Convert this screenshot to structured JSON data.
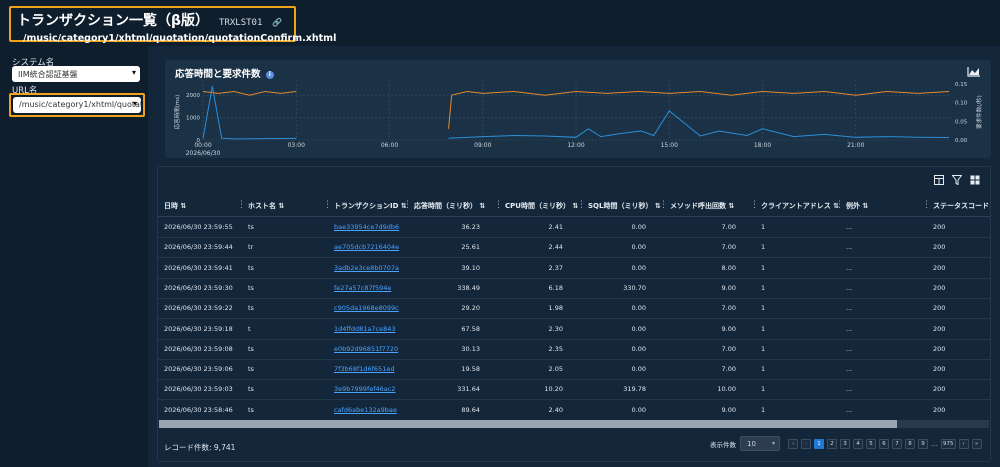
{
  "header": {
    "title": "トランザクション一覧（β版）",
    "code": "TRXLST01",
    "path": "/music/category1/xhtml/quotation/quotationConfirm.xhtml"
  },
  "sidebar": {
    "system_label": "システム名",
    "system_value": "IIM統合認証基盤",
    "url_label": "URL名",
    "url_value": "/music/category1/xhtml/quotation"
  },
  "chart": {
    "title": "応答時間と要求件数",
    "date_label": "2026/06/30",
    "y_left_label": "応答時間(ms)",
    "y_right_label": "要求件数(/秒)",
    "y_left_ticks": [
      "0",
      "1000",
      "2000"
    ],
    "y_right_ticks": [
      "0.00",
      "0.05",
      "0.10",
      "0.15"
    ],
    "x_ticks": [
      "00:00",
      "03:00",
      "06:00",
      "09:00",
      "12:00",
      "15:00",
      "18:00",
      "21:00"
    ],
    "colors": {
      "requests": "#e8892b",
      "response": "#2d8fd8"
    }
  },
  "chart_data": {
    "type": "line",
    "title": "応答時間と要求件数",
    "xlabel": "",
    "ylabel": "応答時間(ms)",
    "y2label": "要求件数(/秒)",
    "x_ticks": [
      "00:00",
      "03:00",
      "06:00",
      "09:00",
      "12:00",
      "15:00",
      "18:00",
      "21:00"
    ],
    "ylim": [
      0,
      2500
    ],
    "y2lim": [
      0,
      0.15
    ],
    "series": [
      {
        "name": "要求件数",
        "axis": "right",
        "x_hours": [
          0.0,
          0.5,
          1.0,
          1.5,
          2.0,
          2.5,
          3.0,
          7.9,
          8.0,
          8.5,
          9.0,
          10.0,
          11.0,
          12.0,
          13.0,
          14.0,
          15.0,
          16.0,
          17.0,
          18.0,
          19.0,
          20.0,
          21.0,
          22.0,
          23.0,
          24.0
        ],
        "values": [
          0.13,
          0.125,
          0.13,
          0.12,
          0.13,
          0.125,
          0.13,
          0.03,
          0.12,
          0.13,
          0.125,
          0.13,
          0.12,
          0.13,
          0.125,
          0.13,
          0.125,
          0.13,
          0.12,
          0.13,
          0.125,
          0.13,
          0.12,
          0.13,
          0.125,
          0.13
        ]
      },
      {
        "name": "応答時間",
        "axis": "left",
        "x_hours": [
          0.0,
          0.3,
          0.6,
          1.0,
          2.0,
          3.0,
          7.9,
          9.0,
          10.0,
          11.0,
          12.0,
          12.4,
          12.8,
          13.5,
          14.1,
          14.5,
          15.0,
          16.0,
          16.6,
          17.5,
          18.0,
          19.0,
          20.0,
          21.0,
          22.0,
          23.0,
          24.0
        ],
        "values": [
          60,
          2400,
          80,
          50,
          60,
          70,
          80,
          150,
          200,
          180,
          120,
          500,
          150,
          300,
          400,
          200,
          1300,
          180,
          400,
          200,
          500,
          150,
          250,
          120,
          150,
          120,
          110
        ]
      }
    ]
  },
  "table": {
    "columns": [
      "日時",
      "ホスト名",
      "トランザクションID",
      "応答時間（ミリ秒）",
      "CPU時間（ミリ秒）",
      "SQL時間（ミリ秒）",
      "メソッド呼出回数",
      "クライアントアドレス",
      "例外",
      "ステータスコード"
    ],
    "rows": [
      [
        "2026/06/30 23:59:55",
        "ts",
        "bae33954ce7d9db6",
        "36.23",
        "2.41",
        "0.00",
        "7.00",
        "1",
        "...",
        "200"
      ],
      [
        "2026/06/30 23:59:44",
        "tr",
        "ae705dcb7216404e",
        "25.61",
        "2.44",
        "0.00",
        "7.00",
        "1",
        "...",
        "200"
      ],
      [
        "2026/06/30 23:59:41",
        "ts",
        "3adb2e3ce8b0707a",
        "39.10",
        "2.37",
        "0.00",
        "8.00",
        "1",
        "...",
        "200"
      ],
      [
        "2026/06/30 23:59:30",
        "ts",
        "fe27a57c87f594e",
        "338.49",
        "6.18",
        "330.70",
        "9.00",
        "1",
        "...",
        "200"
      ],
      [
        "2026/06/30 23:59:22",
        "ts",
        "c905da1968e8099c",
        "29.20",
        "1.98",
        "0.00",
        "7.00",
        "1",
        "...",
        "200"
      ],
      [
        "2026/06/30 23:59:18",
        "t",
        "1d4ffdd81a7ce843",
        "67.58",
        "2.30",
        "0.00",
        "9.00",
        "1",
        "...",
        "200"
      ],
      [
        "2026/06/30 23:59:08",
        "ts",
        "e0b92d96851f7720",
        "30.13",
        "2.35",
        "0.00",
        "7.00",
        "1",
        "...",
        "200"
      ],
      [
        "2026/06/30 23:59:06",
        "ts",
        "7f3b68f1d6f651ed",
        "19.58",
        "2.05",
        "0.00",
        "7.00",
        "1",
        "...",
        "200"
      ],
      [
        "2026/06/30 23:59:03",
        "ts",
        "3e9b7999fef46ac2",
        "331.64",
        "10.20",
        "319.78",
        "10.00",
        "1",
        "...",
        "200"
      ],
      [
        "2026/06/30 23:58:46",
        "ts",
        "cafd6abe132a9bae",
        "89.64",
        "2.40",
        "0.00",
        "9.00",
        "1",
        "...",
        "200"
      ]
    ],
    "record_count": "レコード件数: 9,741",
    "page_size_label": "表示件数",
    "page_size_value": "10",
    "pages": [
      "1",
      "2",
      "3",
      "4",
      "5",
      "6",
      "7",
      "8",
      "9"
    ],
    "last_page": "975",
    "current_page": "1"
  }
}
